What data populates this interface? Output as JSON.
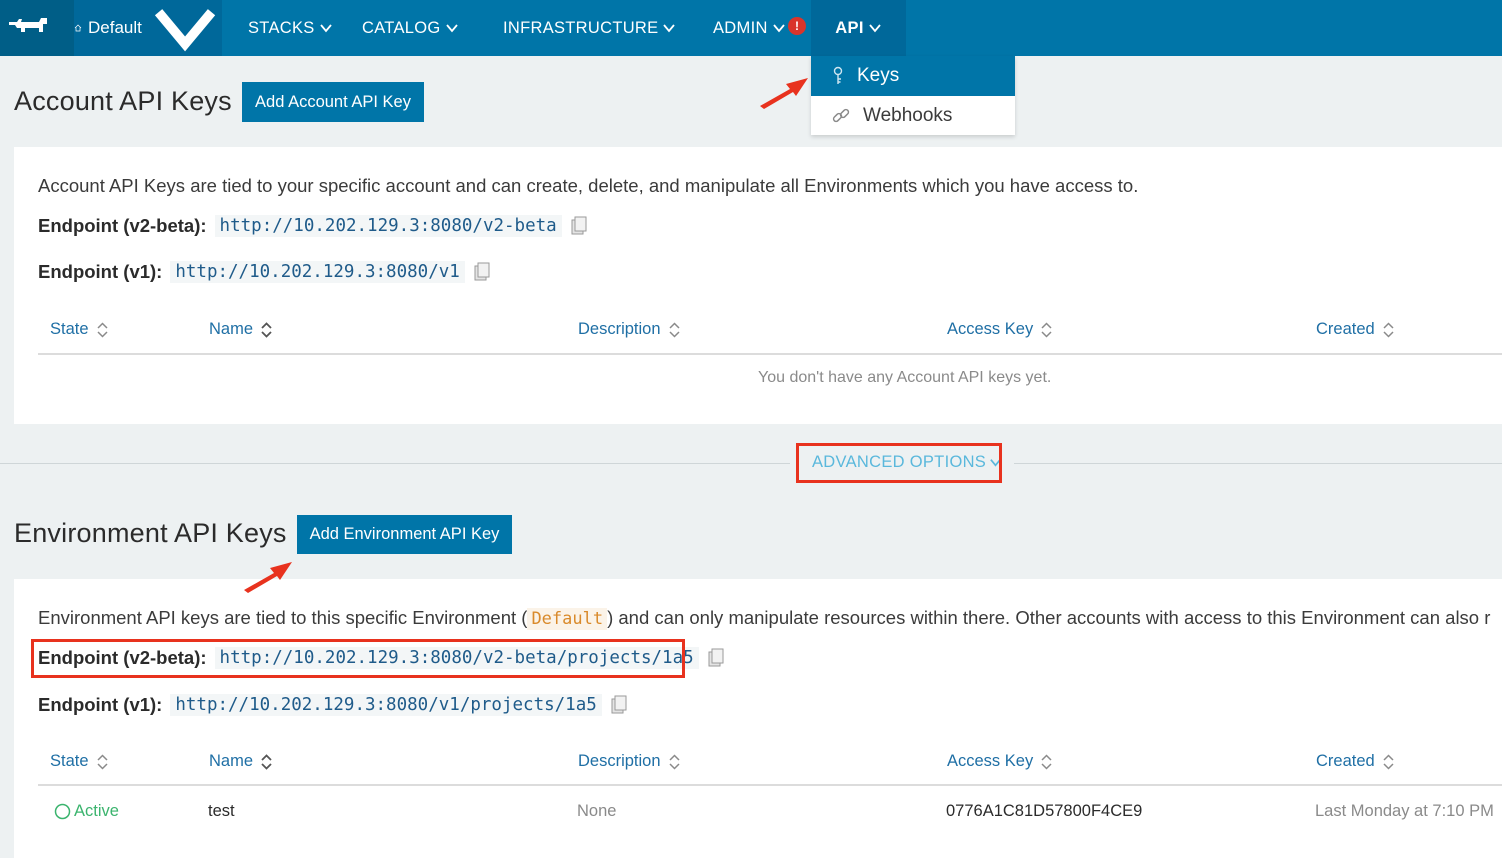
{
  "nav": {
    "env_label": "Default",
    "items": [
      {
        "label": "STACKS"
      },
      {
        "label": "CATALOG"
      },
      {
        "label": "INFRASTRUCTURE"
      },
      {
        "label": "ADMIN"
      },
      {
        "label": "API"
      }
    ],
    "admin_badge": "!"
  },
  "api_menu": {
    "items": [
      {
        "label": "Keys",
        "icon": "key-icon",
        "active": true
      },
      {
        "label": "Webhooks",
        "icon": "link-icon",
        "active": false
      }
    ]
  },
  "account": {
    "title": "Account API Keys",
    "add_button": "Add Account API Key",
    "description": "Account API Keys are tied to your specific account and can create, delete, and manipulate all Environments which you have access to.",
    "endpoint_v2_label": "Endpoint (v2-beta):",
    "endpoint_v2": "http://10.202.129.3:8080/v2-beta",
    "endpoint_v1_label": "Endpoint (v1):",
    "endpoint_v1": "http://10.202.129.3:8080/v1",
    "columns": [
      "State",
      "Name",
      "Description",
      "Access Key",
      "Created"
    ],
    "empty_message": "You don't have any Account API keys yet."
  },
  "advanced_options": "ADVANCED OPTIONS",
  "environment": {
    "title": "Environment API Keys",
    "add_button": "Add Environment API Key",
    "description_before": "Environment API keys are tied to this specific Environment (",
    "env_name": "Default",
    "description_after": ") and can only manipulate resources within there. Other accounts with access to this Environment can also r",
    "endpoint_v2_label": "Endpoint (v2-beta):",
    "endpoint_v2": "http://10.202.129.3:8080/v2-beta/projects/1a5",
    "endpoint_v1_label": "Endpoint (v1):",
    "endpoint_v1": "http://10.202.129.3:8080/v1/projects/1a5",
    "columns": [
      "State",
      "Name",
      "Description",
      "Access Key",
      "Created"
    ],
    "rows": [
      {
        "state": "Active",
        "name": "test",
        "description": "None",
        "access_key": "0776A1C81D57800F4CE9",
        "created": "Last Monday at 7:10 PM"
      }
    ]
  },
  "colors": {
    "nav_bg": "#0075a8",
    "nav_dark": "#00689a",
    "logo_bg": "#005e87",
    "link": "#1f6fa5",
    "active_green": "#3bb46e",
    "annotation_red": "#e8321e"
  }
}
